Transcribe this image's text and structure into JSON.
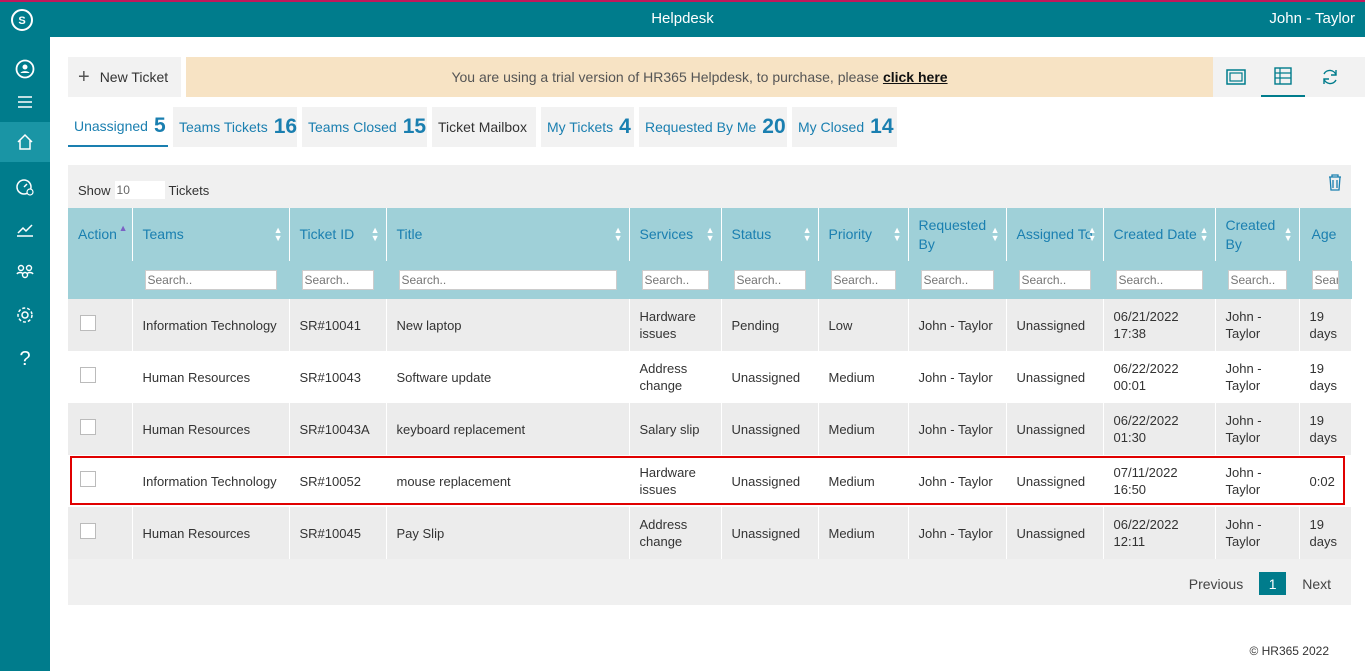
{
  "app": {
    "title": "Helpdesk",
    "user": "John - Taylor"
  },
  "sidebar": {
    "items": [
      {
        "icon": "team-icon"
      },
      {
        "icon": "menu-icon"
      },
      {
        "icon": "home-icon",
        "active": true
      },
      {
        "icon": "dashboard-icon"
      },
      {
        "icon": "chart-icon"
      },
      {
        "icon": "users-icon"
      },
      {
        "icon": "gear-icon"
      },
      {
        "icon": "help-icon",
        "label": "?"
      }
    ]
  },
  "toolbar": {
    "new_ticket": "New Ticket",
    "trial_text": "You are using a trial version of HR365 Helpdesk, to purchase, please",
    "trial_link": "click here"
  },
  "tabs": [
    {
      "label": "Unassigned",
      "count": "5"
    },
    {
      "label": "Teams Tickets",
      "count": "16"
    },
    {
      "label": "Teams Closed",
      "count": "15"
    },
    {
      "label": "Ticket Mailbox",
      "count": ""
    },
    {
      "label": "My Tickets",
      "count": "4"
    },
    {
      "label": "Requested By Me",
      "count": "20"
    },
    {
      "label": "My Closed",
      "count": "14"
    }
  ],
  "table": {
    "show_label": "Show",
    "show_value": "10",
    "tickets_label": "Tickets",
    "columns": [
      "Action",
      "Teams",
      "Ticket ID",
      "Title",
      "Services",
      "Status",
      "Priority",
      "Requested By",
      "Assigned To",
      "Created Date",
      "Created By",
      "Age"
    ],
    "search_placeholder": "Search..",
    "rows": [
      {
        "team": "Information Technology",
        "id": "SR#10041",
        "title": "New laptop",
        "services": "Hardware issues",
        "status": "Pending",
        "priority": "Low",
        "requested_by": "John - Taylor",
        "assigned_to": "Unassigned",
        "created_date": "06/21/2022 17:38",
        "created_by": "John - Taylor",
        "age": "19 days"
      },
      {
        "team": "Human Resources",
        "id": "SR#10043",
        "title": "Software update",
        "services": "Address change",
        "status": "Unassigned",
        "priority": "Medium",
        "requested_by": "John - Taylor",
        "assigned_to": "Unassigned",
        "created_date": "06/22/2022 00:01",
        "created_by": "John - Taylor",
        "age": "19 days"
      },
      {
        "team": "Human Resources",
        "id": "SR#10043A",
        "title": "keyboard replacement",
        "services": "Salary slip",
        "status": "Unassigned",
        "priority": "Medium",
        "requested_by": "John - Taylor",
        "assigned_to": "Unassigned",
        "created_date": "06/22/2022 01:30",
        "created_by": "John - Taylor",
        "age": "19 days"
      },
      {
        "team": "Information Technology",
        "id": "SR#10052",
        "title": "mouse replacement",
        "services": "Hardware issues",
        "status": "Unassigned",
        "priority": "Medium",
        "requested_by": "John - Taylor",
        "assigned_to": "Unassigned",
        "created_date": "07/11/2022 16:50",
        "created_by": "John - Taylor",
        "age": "0:02"
      },
      {
        "team": "Human Resources",
        "id": "SR#10045",
        "title": "Pay Slip",
        "services": "Address change",
        "status": "Unassigned",
        "priority": "Medium",
        "requested_by": "John - Taylor",
        "assigned_to": "Unassigned",
        "created_date": "06/22/2022 12:11",
        "created_by": "John - Taylor",
        "age": "19 days"
      }
    ]
  },
  "pager": {
    "previous": "Previous",
    "page": "1",
    "next": "Next"
  },
  "footer": "© HR365 2022",
  "colors": {
    "brand": "#007c8c",
    "accent": "#1a7fb0",
    "header_bg": "#9fd0d8",
    "trial_bg": "#f7e3c4",
    "highlight": "#e00000"
  }
}
